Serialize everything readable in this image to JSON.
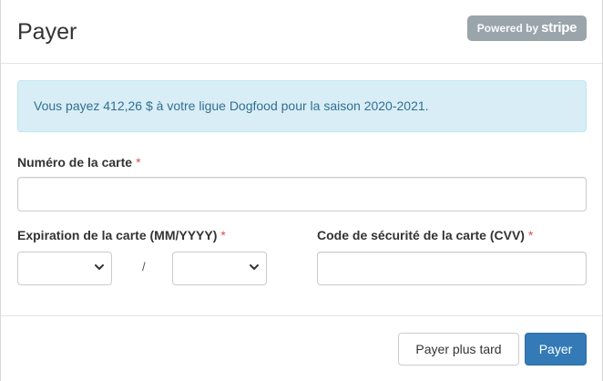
{
  "modal": {
    "title": "Payer",
    "badge": {
      "prefix": "Powered by",
      "brand": "stripe"
    }
  },
  "alert": {
    "text": "Vous payez 412,26 $ à votre ligue Dogfood pour la saison 2020-2021."
  },
  "form": {
    "card_number_label": "Numéro de la carte",
    "card_number_value": "",
    "expiration_label": "Expiration de la carte (MM/YYYY)",
    "expiration_month_value": "",
    "expiration_year_value": "",
    "separator": "/",
    "cvv_label": "Code de sécurité de la carte (CVV)",
    "cvv_value": "",
    "required_marker": "*"
  },
  "footer": {
    "later_label": "Payer plus tard",
    "pay_label": "Payer"
  },
  "colors": {
    "primary": "#337ab7",
    "alert_bg": "#d9edf7",
    "alert_text": "#31708f",
    "required": "#d9534f",
    "badge_bg": "#9aa4ab"
  },
  "icons": [
    "chevron-down-icon"
  ]
}
